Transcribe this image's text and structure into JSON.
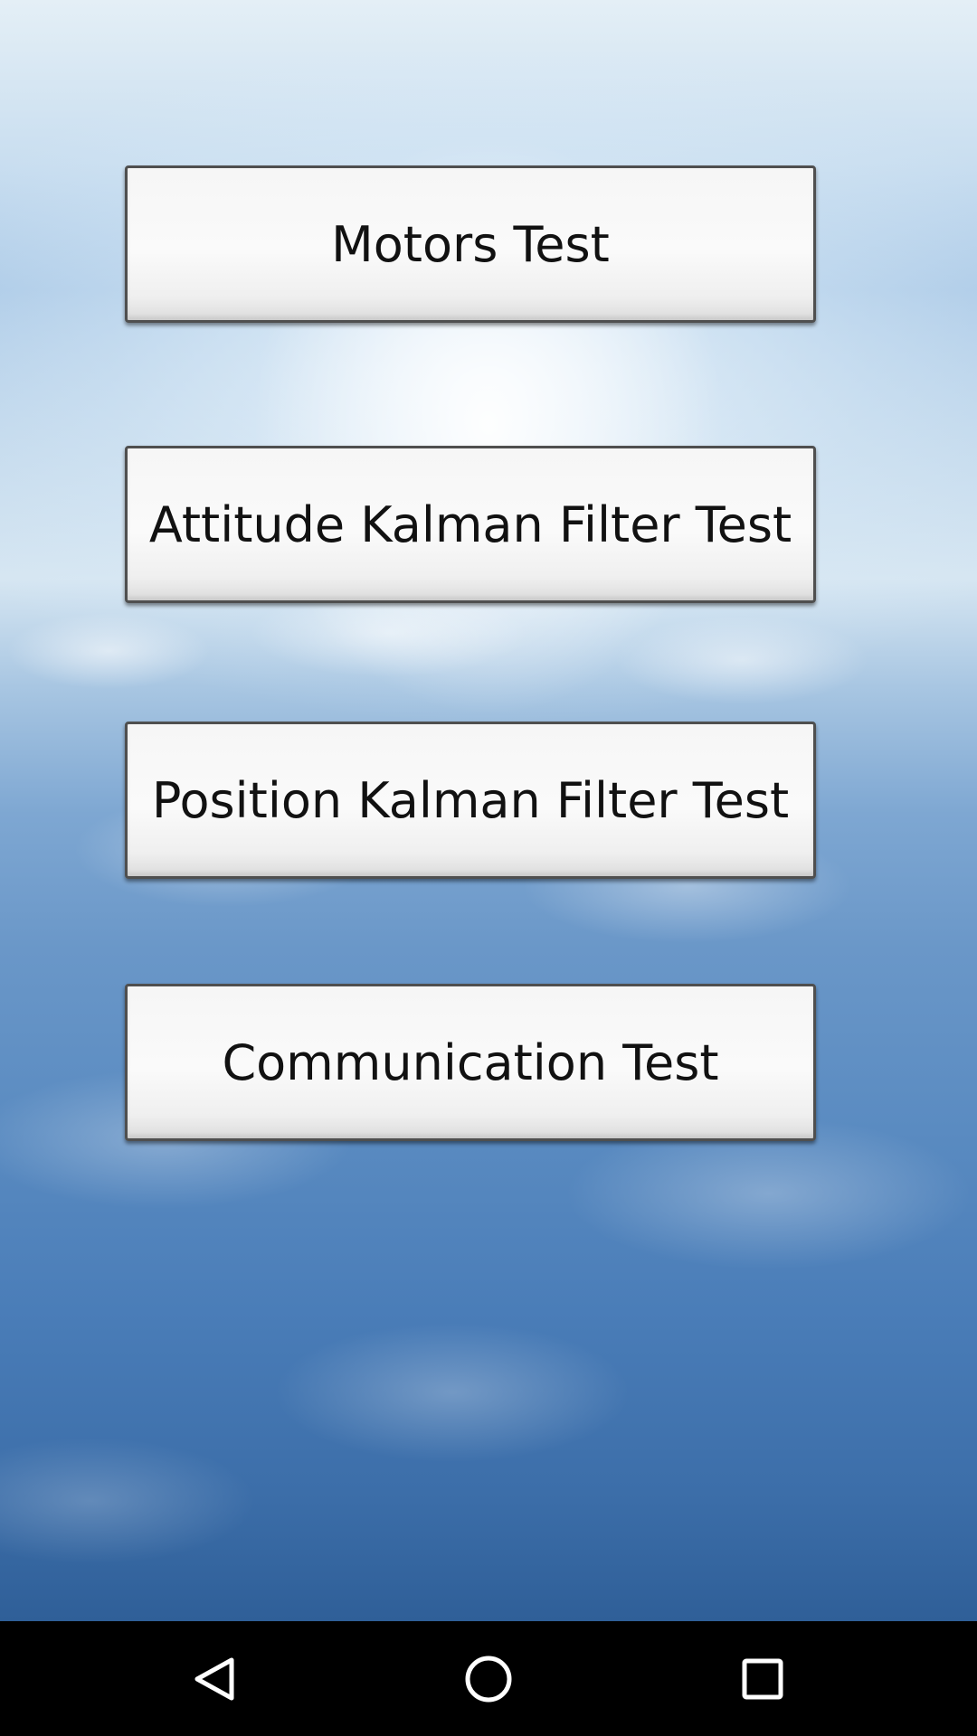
{
  "buttons": [
    {
      "label": "Motors Test"
    },
    {
      "label": "Attitude Kalman Filter Test"
    },
    {
      "label": "Position Kalman Filter Test"
    },
    {
      "label": "Communication Test"
    }
  ],
  "nav_bar": {
    "items": [
      {
        "icon": "back-triangle-icon"
      },
      {
        "icon": "home-circle-icon"
      },
      {
        "icon": "recents-square-icon"
      }
    ],
    "icon_color": "#ffffff",
    "background_color": "#000000"
  }
}
